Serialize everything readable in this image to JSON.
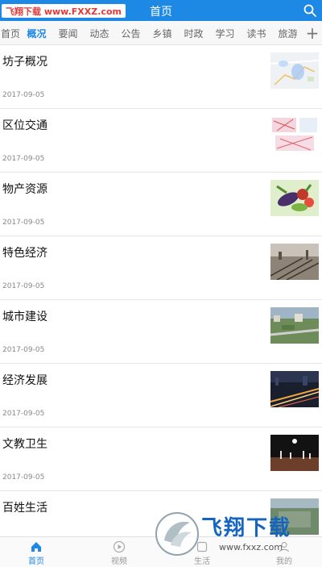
{
  "header": {
    "logo_text": "飞翔下载 www.FXXZ.com",
    "title": "首页"
  },
  "tabs": [
    "首页",
    "概况",
    "要闻",
    "动态",
    "公告",
    "乡镇",
    "时政",
    "学习",
    "读书",
    "旅游"
  ],
  "active_tab": "概况",
  "tab_plus": "+",
  "articles": [
    {
      "title": "坊子概况",
      "date": "2017-09-05",
      "thumb": "map"
    },
    {
      "title": "区位交通",
      "date": "2017-09-05",
      "thumb": "traffic-map"
    },
    {
      "title": "物产资源",
      "date": "2017-09-05",
      "thumb": "vegetables"
    },
    {
      "title": "特色经济",
      "date": "2017-09-05",
      "thumb": "railway"
    },
    {
      "title": "城市建设",
      "date": "2017-09-05",
      "thumb": "city"
    },
    {
      "title": "经济发展",
      "date": "2017-09-05",
      "thumb": "night-road"
    },
    {
      "title": "文教卫生",
      "date": "2017-09-05",
      "thumb": "basketball"
    },
    {
      "title": "百姓生活",
      "date": "",
      "thumb": "life"
    }
  ],
  "bottom_nav": [
    {
      "label": "首页",
      "icon": "home-icon",
      "active": true
    },
    {
      "label": "视频",
      "icon": "play-icon",
      "active": false
    },
    {
      "label": "生活",
      "icon": "life-icon",
      "active": false
    },
    {
      "label": "我的",
      "icon": "user-icon",
      "active": false
    }
  ],
  "watermark": {
    "label": "飞翔下载",
    "url": "www.fxxz.com"
  },
  "colors": {
    "accent": "#1e88e5",
    "logo_red": "#e53935"
  }
}
